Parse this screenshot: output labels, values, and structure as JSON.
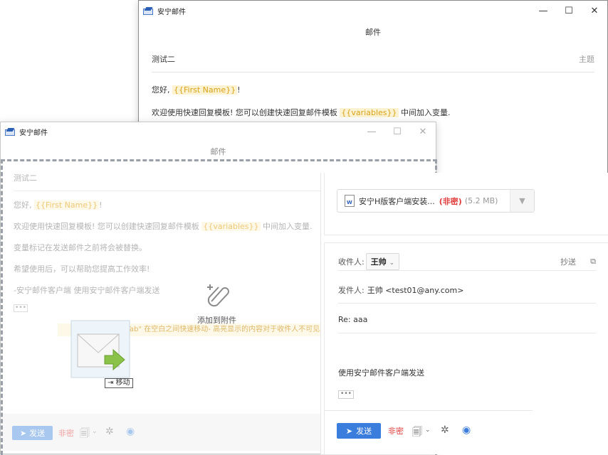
{
  "app": {
    "title": "安宁邮件",
    "window_title": "邮件"
  },
  "window_controls": {
    "minimize": "—",
    "maximize": "☐",
    "close": "✕"
  },
  "back_window": {
    "subject": "测试二",
    "subject_placeholder": "主题",
    "greeting_prefix": "您好, ",
    "greeting_var": "{{First Name}}",
    "greeting_suffix": "!",
    "line2_prefix": "欢迎使用快速回复模板! 您可以创建快速回复邮件模板 ",
    "line2_var": "{{variables}}",
    "line2_suffix": " 中间加入变量."
  },
  "front_window": {
    "subject": "测试二",
    "greeting_prefix": "您好, ",
    "greeting_var": "{{First Name}}",
    "greeting_suffix": "!",
    "line2_prefix": "欢迎使用快速回复模板! 您可以创建快速回复邮件模板 ",
    "line2_var": "{{variables}}",
    "line2_suffix": " 中间加入变量.",
    "line3": "变量标记在发送邮件之前将会被替换。",
    "line4": "希望使用后，可以帮助您提高工作效率!",
    "line5": "-安宁邮件客户端 使用安宁邮件客户端发送",
    "more": "•••",
    "hint": "按\"Tab\" 在空白之间快速移动- 高亮显示的内容对于收件人不可见",
    "drop_label": "添加到附件",
    "drag_tooltip": "移动",
    "send_label": "发送",
    "secret_label": "非密"
  },
  "compose": {
    "attachment_name": "安宁H版客户端安装...",
    "attachment_secret": "(非密)",
    "attachment_size": "(5.2 MB)",
    "to_label": "收件人:",
    "to_recipient": "王帅",
    "cc_label": "抄送",
    "from_label": "发件人:",
    "from_value": "王帅 <test01@any.com>",
    "subject": "Re: aaa",
    "signature": "使用安宁邮件客户端发送",
    "more": "•••",
    "send_label": "发送",
    "secret_label": "非密"
  },
  "colors": {
    "accent": "#3b7ddd",
    "secret": "#e03a3a",
    "variable": "#d9a21b"
  }
}
